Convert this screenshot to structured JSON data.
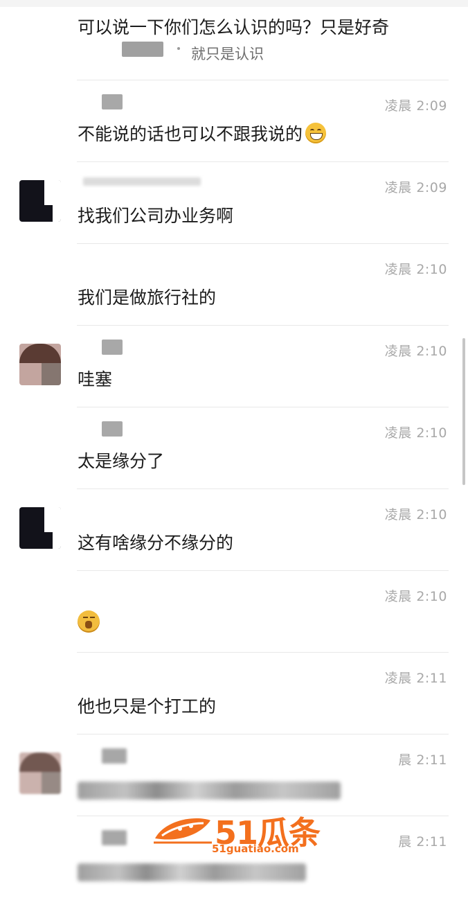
{
  "chat": {
    "top": {
      "question": "可以说一下你们怎么认识的吗？只是好奇",
      "reply_preview": "就只是认识"
    },
    "messages": [
      {
        "time": "凌晨 2:09",
        "text": "不能说的话也可以不跟我说的",
        "emoji": "grinning-face-icon",
        "avatar": "none"
      },
      {
        "time": "凌晨 2:09",
        "text": "找我们公司办业务啊",
        "avatar": "dark"
      },
      {
        "time": "凌晨 2:10",
        "text": "我们是做旅行社的",
        "avatar": "none"
      },
      {
        "time": "凌晨 2:10",
        "text": "哇塞",
        "avatar": "pink"
      },
      {
        "time": "凌晨 2:10",
        "text": "太是缘分了",
        "avatar": "none"
      },
      {
        "time": "凌晨 2:10",
        "text": "这有啥缘分不缘分的",
        "avatar": "dark"
      },
      {
        "time": "凌晨 2:10",
        "text": "",
        "emoji": "facepalm-emoji-icon",
        "avatar": "none"
      },
      {
        "time": "凌晨 2:11",
        "text": "他也只是个打工的",
        "avatar": "none"
      },
      {
        "time": "晨 2:11",
        "text": "",
        "blurred": true,
        "avatar": "pink-blur"
      },
      {
        "time": "晨 2:11",
        "text": "",
        "blurred": true,
        "avatar": "none"
      }
    ]
  },
  "watermark": {
    "title": "51瓜条",
    "url": "51guatiao.com",
    "color": "#f3701e"
  },
  "colors": {
    "time": "#a8a8a8",
    "divider": "#e8e8e8",
    "text": "#1b1b1b"
  }
}
